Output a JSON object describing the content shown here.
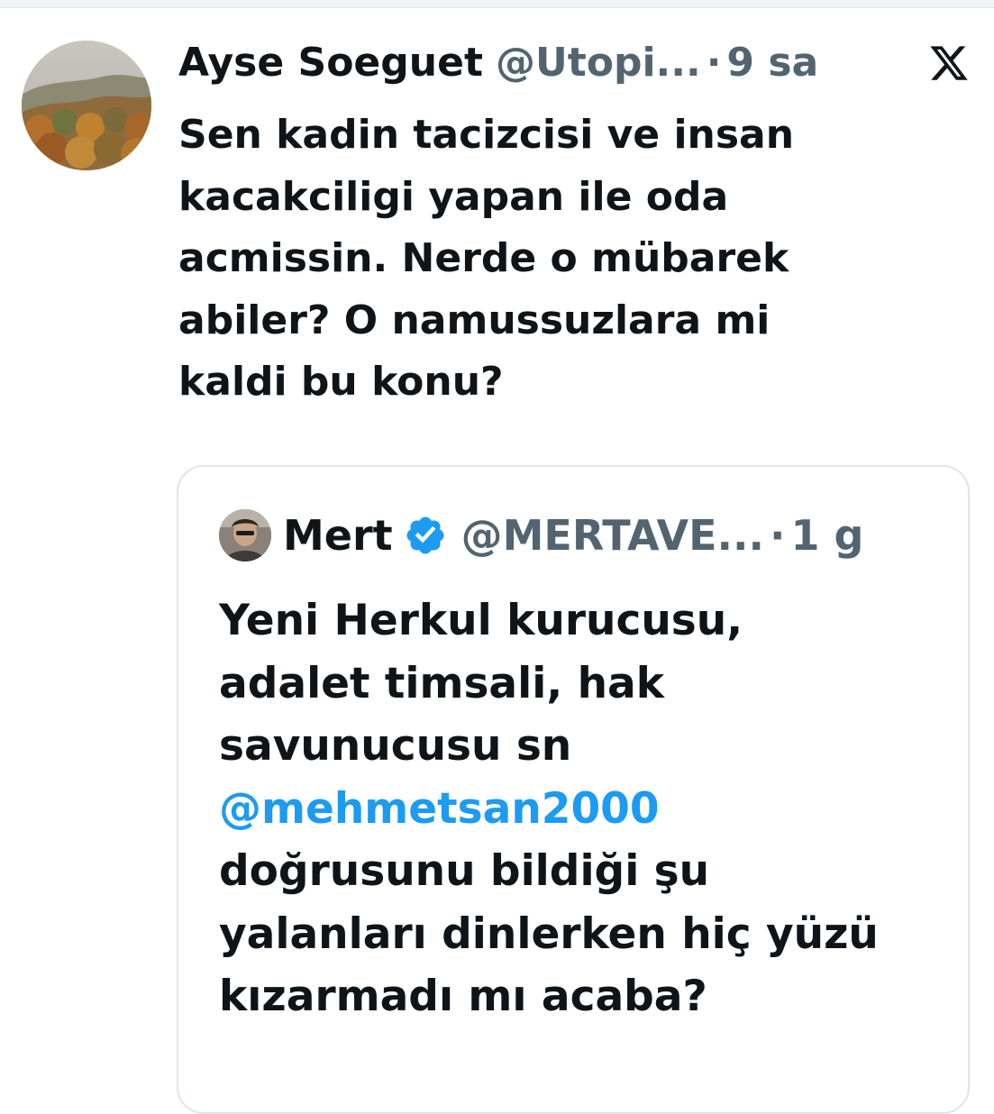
{
  "tweet": {
    "author_name": "Ayse Soeguet",
    "author_handle": "@Utopi...",
    "separator": "·",
    "time": "9 sa",
    "text": "Sen kadin tacizcisi ve insan\nkacakciligi yapan ile oda\nacmissin. Nerde o mübarek\nabiler? O namussuzlara mi\nkaldi bu konu?"
  },
  "quoted_tweet": {
    "author_name": "Mert",
    "author_handle": "@MERTAVE...",
    "separator": "·",
    "time": "1 g",
    "lines": [
      "Yeni Herkul kurucusu,",
      "adalet timsali, hak",
      "savunucusu sn",
      "@mehmetsan2000",
      "doğrusunu bildiği şu",
      "yalanları dinlerken hiç yüzü",
      "kızarmadı mı acaba?"
    ]
  },
  "icons": {
    "logo": "x-logo-icon",
    "verified": "verified-badge-icon"
  },
  "colors": {
    "text_primary": "#0f1419",
    "text_secondary": "#536471",
    "link": "#1d9bf0",
    "verified_badge": "#1d9bf0",
    "card_border": "#dfe5e8"
  }
}
